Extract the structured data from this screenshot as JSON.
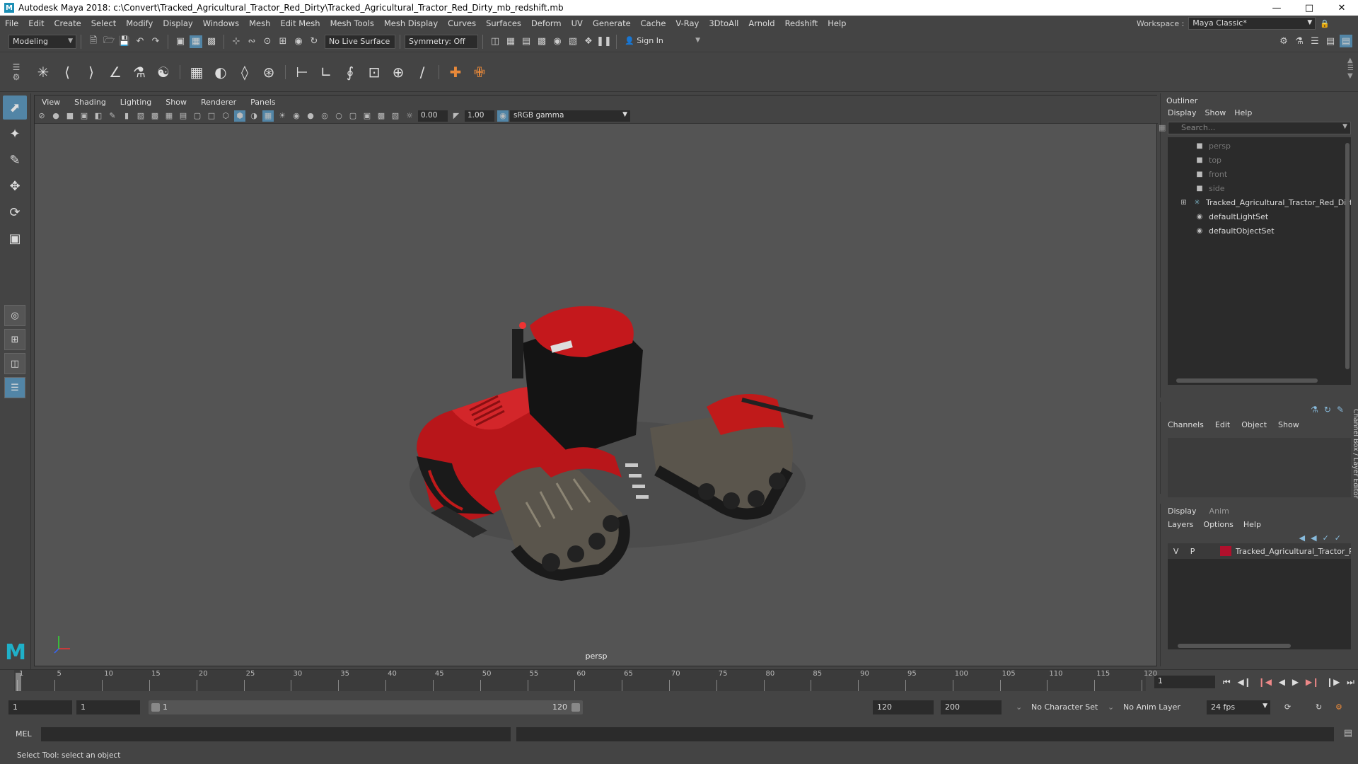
{
  "window": {
    "title": "Autodesk Maya 2018: c:\\Convert\\Tracked_Agricultural_Tractor_Red_Dirty\\Tracked_Agricultural_Tractor_Red_Dirty_mb_redshift.mb",
    "logo": "M"
  },
  "menubar": {
    "items": [
      "File",
      "Edit",
      "Create",
      "Select",
      "Modify",
      "Display",
      "Windows",
      "Mesh",
      "Edit Mesh",
      "Mesh Tools",
      "Mesh Display",
      "Curves",
      "Surfaces",
      "Deform",
      "UV",
      "Generate",
      "Cache",
      "V-Ray",
      "3DtoAll",
      "Arnold",
      "Redshift",
      "Help"
    ],
    "workspace_label": "Workspace :",
    "workspace_value": "Maya Classic*"
  },
  "statusline": {
    "mode": "Modeling",
    "live_surface": "No Live Surface",
    "symmetry": "Symmetry: Off",
    "sign_in": "Sign In"
  },
  "viewport": {
    "menu": [
      "View",
      "Shading",
      "Lighting",
      "Show",
      "Renderer",
      "Panels"
    ],
    "exposure": "0.00",
    "gamma": "1.00",
    "color_space": "sRGB gamma",
    "camera": "persp"
  },
  "outliner": {
    "title": "Outliner",
    "menu": [
      "Display",
      "Show",
      "Help"
    ],
    "search_placeholder": "Search...",
    "cameras": [
      "persp",
      "top",
      "front",
      "side"
    ],
    "mesh": "Tracked_Agricultural_Tractor_Red_Dirty_r",
    "sets": [
      "defaultLightSet",
      "defaultObjectSet"
    ]
  },
  "channelbox": {
    "menu": [
      "Channels",
      "Edit",
      "Object",
      "Show"
    ],
    "side_tab": "Channel Box / Layer Editor"
  },
  "layereditor": {
    "tabs": [
      "Display",
      "Anim"
    ],
    "menu": [
      "Layers",
      "Options",
      "Help"
    ],
    "layer": {
      "v": "V",
      "p": "P",
      "name": "Tracked_Agricultural_Tractor_R",
      "color": "#b0102c"
    }
  },
  "timeline": {
    "ticks": [
      1,
      5,
      10,
      15,
      20,
      25,
      30,
      35,
      40,
      45,
      50,
      55,
      60,
      65,
      70,
      75,
      80,
      85,
      90,
      95,
      100,
      105,
      110,
      115,
      120
    ],
    "current_frame": "1"
  },
  "range": {
    "start": "1",
    "playback_start": "1",
    "bar_start": "1",
    "bar_end": "120",
    "playback_end": "120",
    "end": "200",
    "character_set": "No Character Set",
    "anim_layer": "No Anim Layer",
    "fps": "24 fps"
  },
  "cmdline": {
    "label": "MEL"
  },
  "helpline": {
    "text": "Select Tool: select an object"
  }
}
